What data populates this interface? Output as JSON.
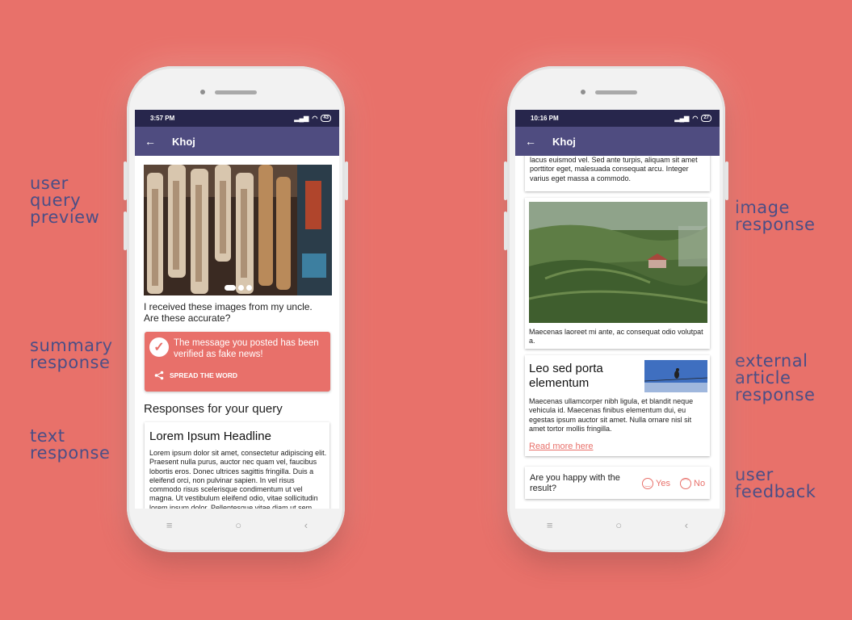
{
  "annotations": {
    "user_query_preview": [
      "user",
      "query",
      "preview"
    ],
    "summary_response": [
      "summary",
      "response"
    ],
    "text_response": [
      "text",
      "response"
    ],
    "image_response": [
      "image",
      "response"
    ],
    "external_article_response": [
      "external",
      "article",
      "response"
    ],
    "user_feedback": [
      "user",
      "feedback"
    ]
  },
  "left_phone": {
    "status_time": "3:57 PM",
    "battery": "43",
    "app_title": "Khoj",
    "query_text": "I received these images from my uncle. Are these accurate?",
    "summary_message": "The message you posted has been verified as fake news!",
    "spread_label": "SPREAD THE WORD",
    "responses_title": "Responses for your query",
    "text_card_headline": "Lorem Ipsum Headline",
    "text_card_body": "Lorem ipsum dolor sit amet, consectetur adipiscing elit. Praesent nulla purus, auctor nec quam vel, faucibus lobortis eros. Donec ultrices sagittis fringilla. Duis a eleifend orci, non pulvinar sapien. In vel risus commodo risus scelerisque condimentum ut vel magna. Ut vestibulum eleifend odio, vitae sollicitudin lorem ipsum dolor. Pellentesque vitae diam ut sem"
  },
  "right_phone": {
    "status_time": "10:16 PM",
    "battery": "27",
    "app_title": "Khoj",
    "top_text": "lacus euismod vel. Sed ante turpis, aliquam sit amet porttitor eget, malesuada consequat arcu. Integer varius eget massa a commodo.",
    "image_caption": "Maecenas laoreet mi ante, ac consequat odio volutpat a.",
    "article_title": "Leo sed porta elementum",
    "article_body": "Maecenas ullamcorper nibh ligula, et blandit neque vehicula id. Maecenas finibus elementum dui, eu egestas ipsum auctor sit amet. Nulla ornare nisl sit amet tortor mollis fringilla.",
    "read_more": "Read more here",
    "feedback_question": "Are you happy with the result?",
    "yes_label": "Yes",
    "no_label": "No"
  },
  "icons": {
    "back": "arrow-left-icon",
    "check": "check-circle-icon",
    "share": "share-icon",
    "smile": "smile-icon",
    "frown": "frown-icon",
    "nav_menu": "menu-icon",
    "nav_home": "home-circle-icon",
    "nav_back": "chevron-left-icon"
  },
  "colors": {
    "background": "#e8716a",
    "appbar": "#4f4c80",
    "statusbar": "#27264c",
    "annotation": "#4a4e86",
    "accent": "#e8706a"
  }
}
